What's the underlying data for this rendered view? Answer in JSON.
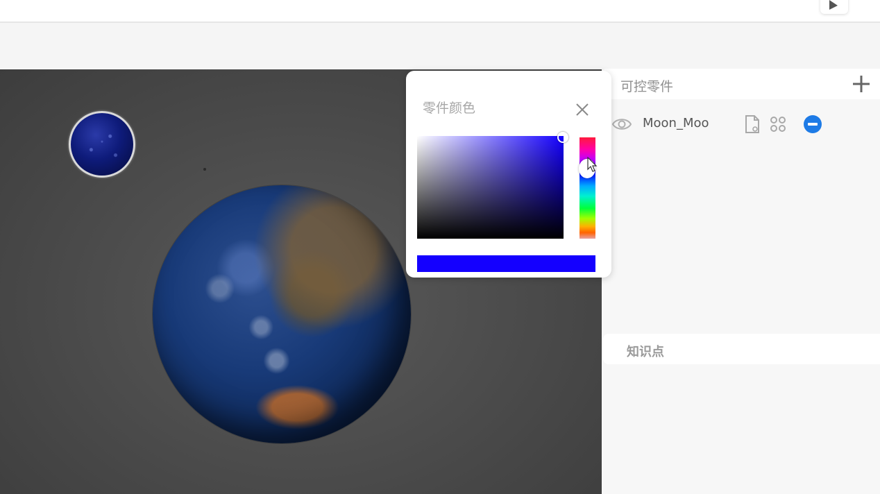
{
  "colors": {
    "accent": "#1e7be6",
    "selected_color": "#1400ff",
    "panel_bg": "#f7f7f7",
    "viewport_bg": "#4d4d4d"
  },
  "toolbar": {
    "play_icon": "play-icon"
  },
  "right_panel": {
    "parts_title": "可控零件",
    "add_icon": "plus-icon",
    "parts": [
      {
        "name": "Moon_Moo",
        "icons": [
          "eye-icon",
          "document-icon",
          "grid-icon",
          "remove-icon"
        ]
      }
    ],
    "knowledge_title": "知识点"
  },
  "color_picker": {
    "title": "零件颜色",
    "close_icon": "close-icon",
    "selected_hex": "#1400ff"
  }
}
